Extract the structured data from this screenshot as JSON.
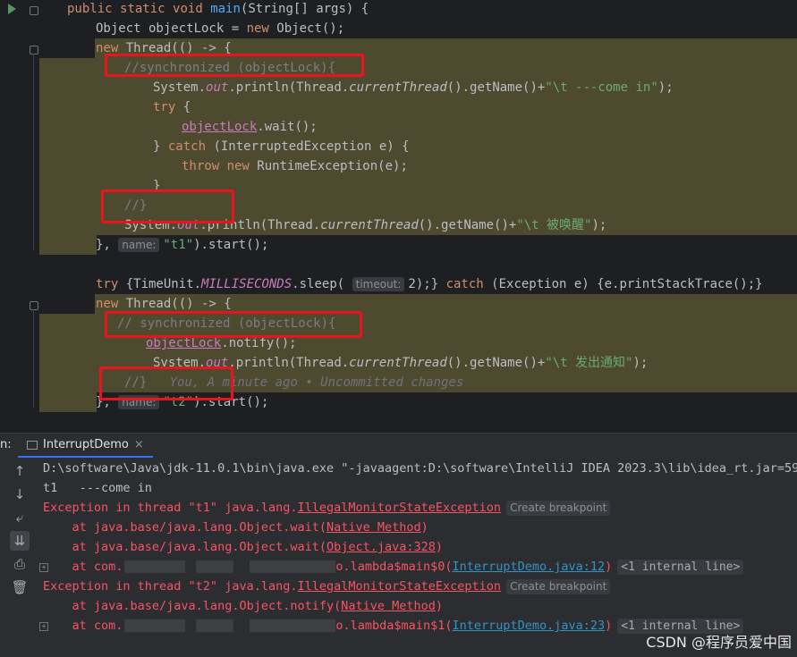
{
  "editor": {
    "lines": [
      {
        "segs": [
          [
            "kw",
            "public "
          ],
          [
            "kw",
            "static "
          ],
          [
            "kw",
            "void "
          ],
          [
            "fn",
            "main"
          ],
          [
            "",
            "(String[] args) {"
          ]
        ]
      },
      {
        "segs": [
          [
            "",
            "Object objectLock = "
          ],
          [
            "kw",
            "new "
          ],
          [
            "",
            "Object();"
          ]
        ]
      },
      {
        "segs": [
          [
            "kw",
            "new "
          ],
          [
            "",
            "Thread(() -> {"
          ]
        ]
      },
      {
        "segs": [
          [
            "cm",
            "//synchronized (objectLock){"
          ]
        ]
      },
      {
        "segs": [
          [
            "",
            "System."
          ],
          [
            "stfld",
            "out"
          ],
          [
            "",
            ".println(Thread."
          ],
          [
            "it",
            "currentThread"
          ],
          [
            "",
            "().getName()+"
          ],
          [
            "st",
            "\"\\t ---come in\""
          ],
          [
            "",
            ");"
          ]
        ]
      },
      {
        "segs": [
          [
            "kw",
            "try "
          ],
          [
            "",
            "{"
          ]
        ]
      },
      {
        "segs": [
          [
            "fld ul",
            "objectLock"
          ],
          [
            "",
            ".wait();"
          ]
        ]
      },
      {
        "segs": [
          [
            "",
            "} "
          ],
          [
            "kw",
            "catch "
          ],
          [
            "",
            "(InterruptedException e) {"
          ]
        ]
      },
      {
        "segs": [
          [
            "kw",
            "throw "
          ],
          [
            "kw",
            "new "
          ],
          [
            "",
            "RuntimeException(e);"
          ]
        ]
      },
      {
        "segs": [
          [
            "",
            "}"
          ]
        ]
      },
      {
        "segs": [
          [
            "cm",
            "//}"
          ]
        ]
      },
      {
        "segs": [
          [
            "",
            "System."
          ],
          [
            "stfld",
            "out"
          ],
          [
            "",
            ".println(Thread."
          ],
          [
            "it",
            "currentThread"
          ],
          [
            "",
            "().getName()+"
          ],
          [
            "st",
            "\"\\t 被唤醒\""
          ],
          [
            "",
            ");"
          ]
        ]
      },
      {
        "segs": [
          [
            "",
            "}, "
          ],
          [
            "hint",
            "name:"
          ],
          [
            "st",
            "\"t1\""
          ],
          [
            "",
            ").start();"
          ]
        ]
      },
      {
        "segs": []
      },
      {
        "segs": [
          [
            "kw",
            "try "
          ],
          [
            "",
            "{TimeUnit."
          ],
          [
            "stfld",
            "MILLISECONDS"
          ],
          [
            "",
            ".sleep( "
          ],
          [
            "hint",
            "timeout:"
          ],
          [
            "",
            "2);} "
          ],
          [
            "kw",
            "catch "
          ],
          [
            "",
            "(Exception e) {e.printStackTrace();}"
          ]
        ]
      },
      {
        "segs": [
          [
            "kw",
            "new "
          ],
          [
            "",
            "Thread(() -> {"
          ]
        ]
      },
      {
        "segs": [
          [
            "cm",
            "// synchronized (objectLock){"
          ]
        ]
      },
      {
        "segs": [
          [
            "fld ul",
            "objectLock"
          ],
          [
            "",
            ".notify();"
          ]
        ]
      },
      {
        "segs": [
          [
            "",
            "System."
          ],
          [
            "stfld",
            "out"
          ],
          [
            "",
            ".println(Thread."
          ],
          [
            "it",
            "currentThread"
          ],
          [
            "",
            "().getName()+"
          ],
          [
            "st",
            "\"\\t 发出通知\""
          ],
          [
            "",
            ");"
          ]
        ]
      },
      {
        "segs": [
          [
            "cm",
            "//}   "
          ],
          [
            "blame",
            "You, A minute ago • Uncommitted changes"
          ]
        ]
      },
      {
        "segs": [
          [
            "",
            "}, "
          ],
          [
            "hint",
            "name:"
          ],
          [
            "st",
            "\"t2\""
          ],
          [
            "",
            ").start();"
          ]
        ]
      }
    ]
  },
  "run_panel": {
    "label": "n:",
    "tab_title": "InterruptDemo",
    "tab_close": "×"
  },
  "console": {
    "cmd": "D:\\software\\Java\\jdk-11.0.1\\bin\\java.exe \"-javaagent:D:\\software\\IntelliJ IDEA 2023.3\\lib\\idea_rt.jar=596",
    "out1": "t1   ---come in",
    "exc1_prefix": "Exception in thread \"t1\" java.lang.",
    "exc_class": "IllegalMonitorStateException",
    "create_bp": "Create breakpoint",
    "at_prefix": "    at java.base/java.lang.Object.wait(",
    "native_method": "Native Method",
    "close_paren": ")",
    "object_java": "Object.java:328",
    "at_com": "    at com.",
    "lambda0": "o.lambda$main$0(",
    "link12": "InterruptDemo.java:12",
    "internal_line": "<1 internal line>",
    "exc2_prefix": "Exception in thread \"t2\" java.lang.",
    "at_notify": "    at java.base/java.lang.Object.notify(",
    "lambda1": "o.lambda$main$1(",
    "link23": "InterruptDemo.java:23"
  },
  "watermark": "CSDN @程序员爱中国"
}
